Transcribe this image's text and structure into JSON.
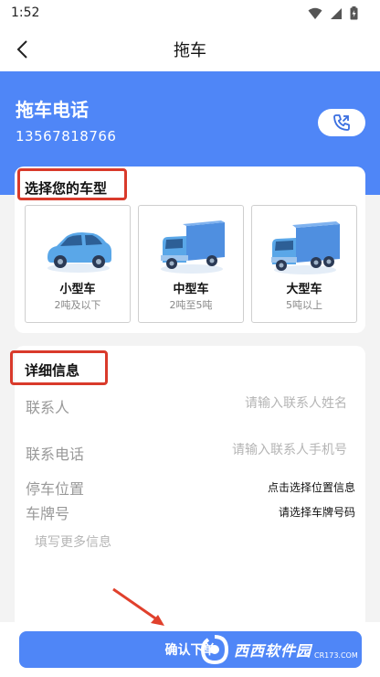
{
  "status": {
    "time": "1:52",
    "icons": [
      "wifi-icon",
      "signal-icon",
      "battery-icon"
    ]
  },
  "appbar": {
    "title": "拖车",
    "back_icon": "chevron-left-icon"
  },
  "header": {
    "title": "拖车电话",
    "phone": "13567818766",
    "call_icon": "phone-call-icon"
  },
  "vehicle_section": {
    "title": "选择您的车型",
    "options": [
      {
        "name": "小型车",
        "desc": "2吨及以下",
        "icon": "car-icon"
      },
      {
        "name": "中型车",
        "desc": "2吨至5吨",
        "icon": "truck-icon"
      },
      {
        "name": "大型车",
        "desc": "5吨以上",
        "icon": "large-truck-icon"
      }
    ]
  },
  "detail_section": {
    "title": "详细信息",
    "contact_label": "联系人",
    "contact_placeholder": "请输入联系人姓名",
    "phone_label": "联系电话",
    "phone_placeholder": "请输入联系人手机号",
    "location_label": "停车位置",
    "location_action": "点击选择位置信息",
    "plate_label": "车牌号",
    "plate_action": "请选择车牌号码",
    "notes_placeholder": "填写更多信息"
  },
  "confirm_button": {
    "label": "确认下单"
  },
  "watermark": {
    "text": "西西软件园",
    "sub": "CR173.COM"
  },
  "colors": {
    "primary": "#4f86f7",
    "highlight": "#d93a2b",
    "vehicle_blue": "#5aa7e8"
  }
}
